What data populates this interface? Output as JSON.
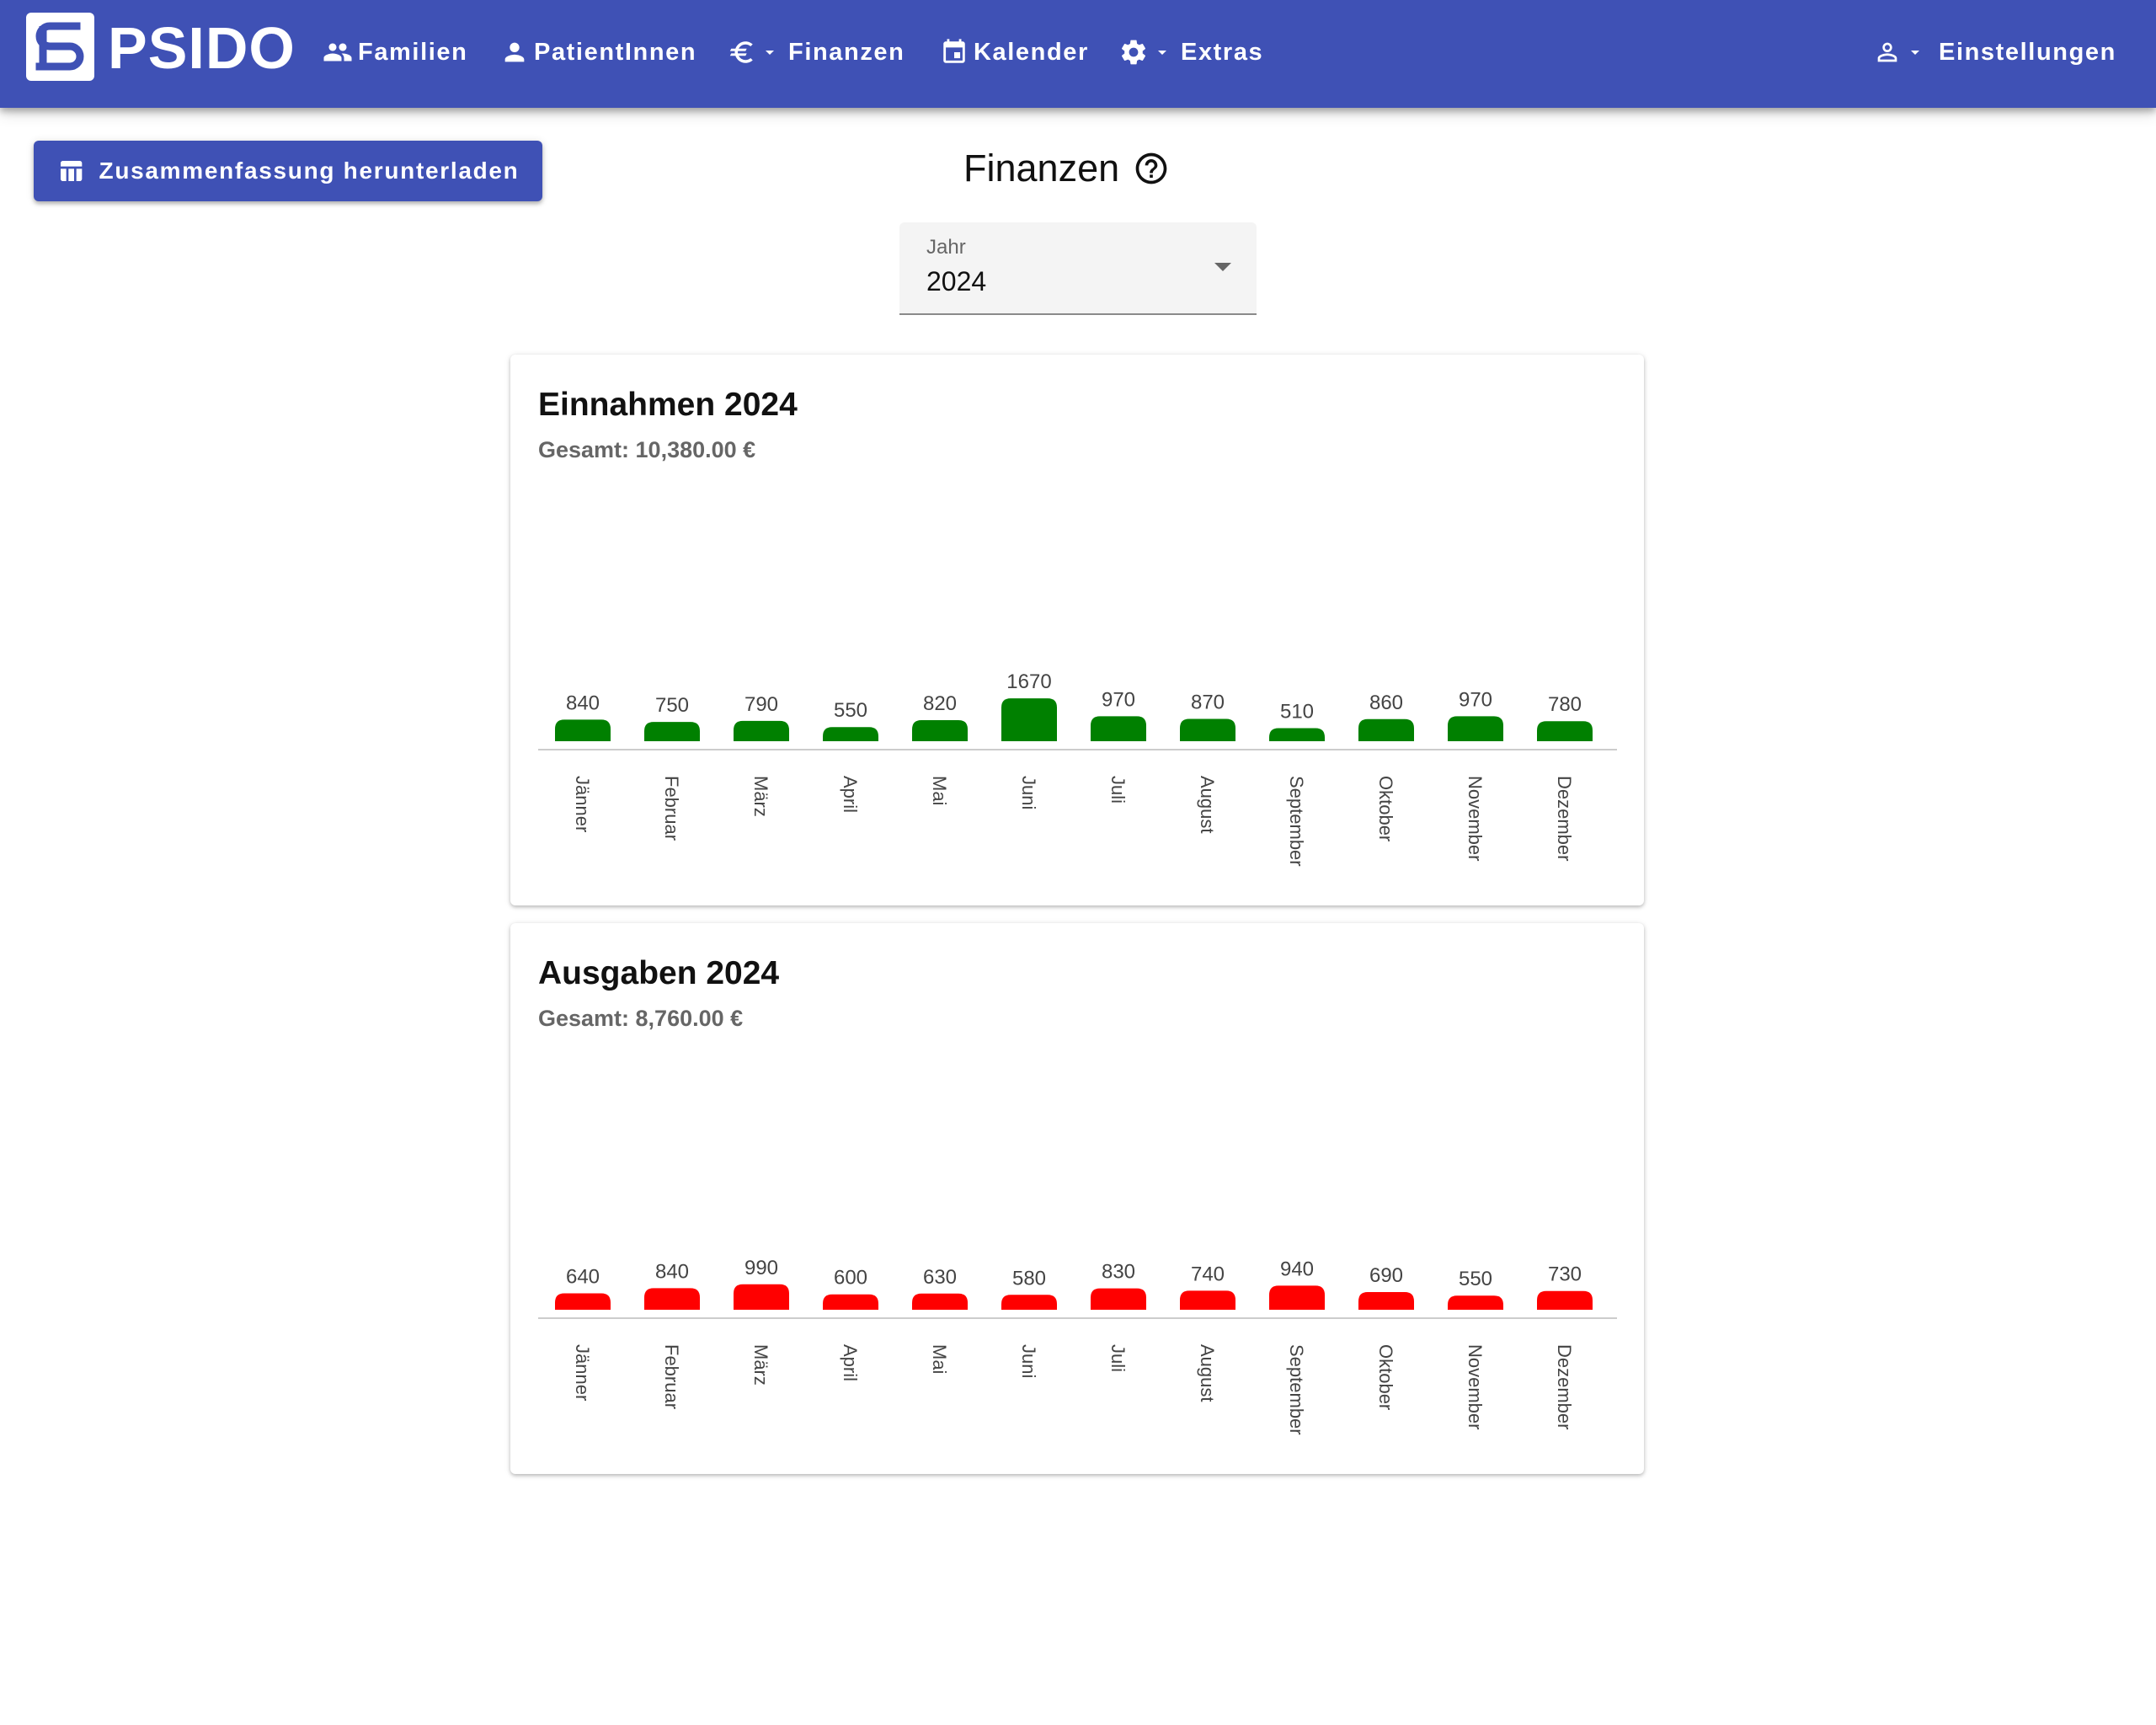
{
  "brand": {
    "name": "PSIDO"
  },
  "nav": {
    "familien": "Familien",
    "patienten": "PatientInnen",
    "finanzen": "Finanzen",
    "kalender": "Kalender",
    "extras": "Extras",
    "einstellungen": "Einstellungen"
  },
  "actions": {
    "download_label": "Zusammenfassung herunterladen"
  },
  "page": {
    "title": "Finanzen"
  },
  "year_select": {
    "label": "Jahr",
    "value": "2024"
  },
  "colors": {
    "primary": "#3f51b5",
    "income_bar": "#008000",
    "expense_bar": "#ff0000",
    "background": "#ffffff"
  },
  "icons": {
    "familien": "people-icon",
    "patienten": "person-icon",
    "finanzen": "euro-icon",
    "kalender": "calendar-icon",
    "extras": "gear-icon",
    "einstellungen": "person-outline-icon",
    "download": "table-icon",
    "help": "help-circle-icon"
  },
  "cards": {
    "income": {
      "title": "Einnahmen 2024",
      "total": "Gesamt: 10,380.00 €"
    },
    "expense": {
      "title": "Ausgaben 2024",
      "total": "Gesamt: 8,760.00 €"
    }
  },
  "chart_data": [
    {
      "type": "bar",
      "title": "Einnahmen 2024",
      "subtitle": "Gesamt: 10,380.00 €",
      "categories": [
        "Jänner",
        "Februar",
        "März",
        "April",
        "Mai",
        "Juni",
        "Juli",
        "August",
        "September",
        "Oktober",
        "November",
        "Dezember"
      ],
      "values": [
        840,
        750,
        790,
        550,
        820,
        1670,
        970,
        870,
        510,
        860,
        970,
        780
      ],
      "color": "#008000",
      "grid": false
    },
    {
      "type": "bar",
      "title": "Ausgaben 2024",
      "subtitle": "Gesamt: 8,760.00 €",
      "categories": [
        "Jänner",
        "Februar",
        "März",
        "April",
        "Mai",
        "Juni",
        "Juli",
        "August",
        "September",
        "Oktober",
        "November",
        "Dezember"
      ],
      "values": [
        640,
        840,
        990,
        600,
        630,
        580,
        830,
        740,
        940,
        690,
        550,
        730
      ],
      "color": "#ff0000",
      "grid": false
    }
  ]
}
